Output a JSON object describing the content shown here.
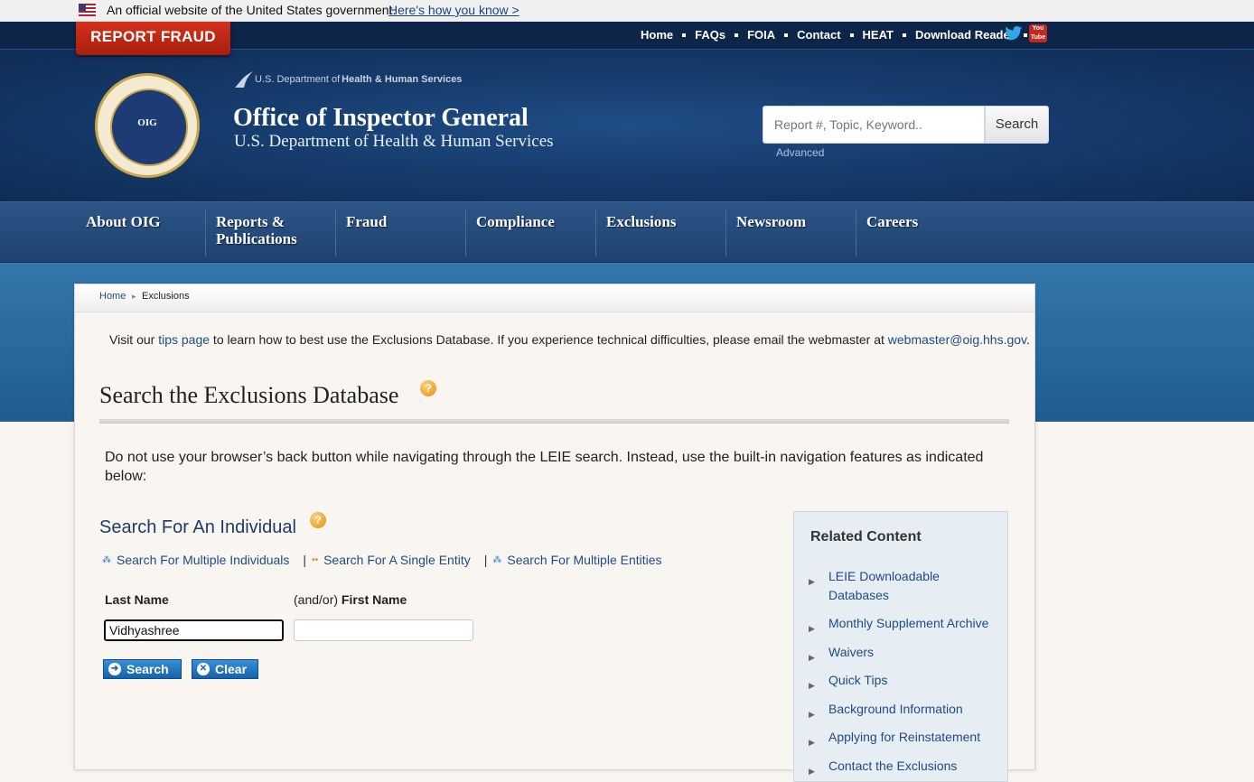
{
  "gov_banner": {
    "text": "An official website of the United States government.",
    "link": "Here's how you know >"
  },
  "report_fraud": "REPORT FRAUD",
  "utility_nav": [
    "Home",
    "FAQs",
    "FOIA",
    "Contact",
    "HEAT",
    "Download Reader"
  ],
  "social": {
    "youtube_label": "You Tube"
  },
  "header": {
    "hhs_prefix": "U.S. Department of",
    "hhs_bold": "Health & Human Services",
    "title": "Office of Inspector General",
    "subtitle": "U.S. Department of Health & Human Services",
    "seal_text": "OIG"
  },
  "search": {
    "placeholder": "Report #, Topic, Keyword..",
    "button": "Search",
    "advanced": "Advanced"
  },
  "main_nav": [
    "About OIG",
    "Reports & Publications",
    "Fraud",
    "Compliance",
    "Exclusions",
    "Newsroom",
    "Careers"
  ],
  "breadcrumb": {
    "home": "Home",
    "sep": "▸",
    "current": "Exclusions"
  },
  "tips": {
    "before": "Visit our ",
    "link": "tips page",
    "middle": " to learn how to best use the Exclusions Database. If you experience technical difficulties, please email the webmaster at ",
    "email": "webmaster@oig.hhs.gov",
    "after": "."
  },
  "page_title": "Search the Exclusions Database",
  "notice": "Do not use your browser’s back button while navigating through the LEIE search. Instead, use the built-in navigation features as indicated below:",
  "individual": {
    "heading": "Search For An Individual",
    "alt_links": [
      "Search For Multiple Individuals",
      "Search For A Single Entity",
      "Search For Multiple Entities"
    ],
    "last_name_label": "Last Name",
    "first_name_prefix": "(and/or)",
    "first_name_label": "First Name",
    "last_name_value": "Vidhyashree",
    "first_name_value": "",
    "search_button": "Search",
    "clear_button": "Clear"
  },
  "related": {
    "title": "Related Content",
    "items": [
      "LEIE Downloadable Databases",
      "Monthly Supplement Archive",
      "Waivers",
      "Quick Tips",
      "Background Information",
      "Applying for Reinstatement",
      "Contact the Exclusions"
    ]
  },
  "colors": {
    "navy": "#0c2549",
    "accent_red": "#c8271e",
    "link_blue": "#1f4a86"
  }
}
